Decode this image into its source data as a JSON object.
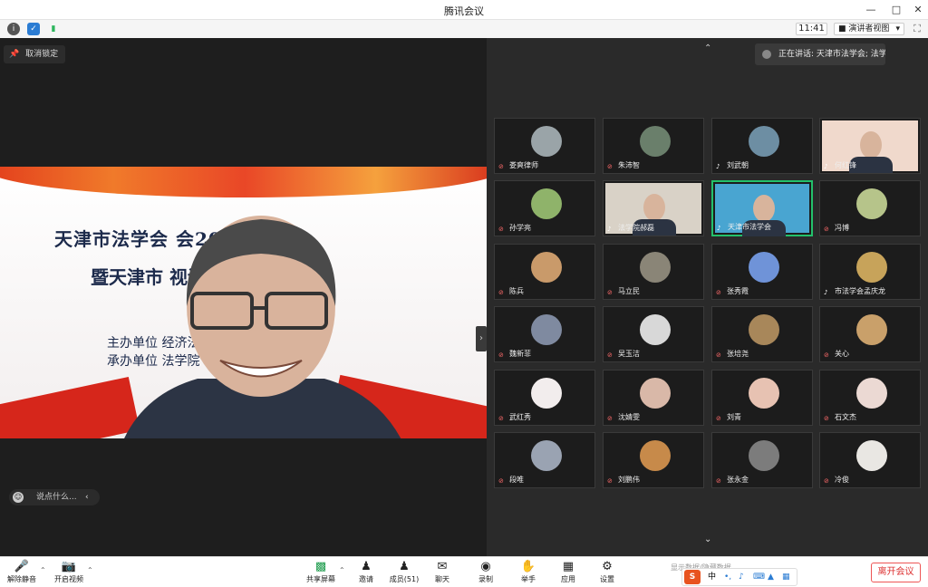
{
  "window": {
    "title": "腾讯会议"
  },
  "infobar": {
    "time": "11:41",
    "view_mode": "演讲者视图"
  },
  "main": {
    "unlock_label": "取消锁定",
    "slide": {
      "line1": "天津市法学会              会2022年年会",
      "line2": "暨天津市              视论坛",
      "line3": "主办单位              经济法学分会",
      "line4": "承办单位              法学院"
    },
    "comment_placeholder": "说点什么..."
  },
  "gallery": {
    "speaking_label": "正在讲话: 天津市法学会; 法学...",
    "participants": [
      {
        "name": "娄爽律师",
        "muted": true,
        "color": "#9aa4a8",
        "type": "photo"
      },
      {
        "name": "朱沛智",
        "muted": true,
        "color": "#6a7f6b",
        "type": "photo"
      },
      {
        "name": "刘武朝",
        "muted": false,
        "color": "#6d8ea3",
        "type": "photo"
      },
      {
        "name": "何红锋",
        "muted": false,
        "color": "#f0d9cc",
        "type": "video"
      },
      {
        "name": "孙学亮",
        "muted": true,
        "color": "#8fb36a",
        "type": "photo"
      },
      {
        "name": "法学院郝磊",
        "muted": false,
        "color": "#d9d2c7",
        "type": "video"
      },
      {
        "name": "天津市法学会",
        "muted": false,
        "color": "#49a5d1",
        "type": "video",
        "active": true
      },
      {
        "name": "冯博",
        "muted": true,
        "color": "#b6c48a",
        "type": "photo"
      },
      {
        "name": "陈兵",
        "muted": true,
        "color": "#c99a6a",
        "type": "photo"
      },
      {
        "name": "马立民",
        "muted": true,
        "color": "#8a8577",
        "type": "photo"
      },
      {
        "name": "张秀霞",
        "muted": true,
        "color": "#6f93d8",
        "type": "photo"
      },
      {
        "name": "市法学会孟庆龙",
        "muted": false,
        "color": "#c7a35a",
        "type": "photo"
      },
      {
        "name": "魏新菲",
        "muted": true,
        "color": "#7f8aa0",
        "type": "photo"
      },
      {
        "name": "吴玉洁",
        "muted": true,
        "color": "#d8d8d8",
        "type": "photo"
      },
      {
        "name": "张培尧",
        "muted": true,
        "color": "#a8875a",
        "type": "photo"
      },
      {
        "name": "关心",
        "muted": true,
        "color": "#c9a06a",
        "type": "photo"
      },
      {
        "name": "武红秀",
        "muted": true,
        "color": "#f2eded",
        "type": "photo"
      },
      {
        "name": "沈婧雯",
        "muted": true,
        "color": "#d9b8a8",
        "type": "photo"
      },
      {
        "name": "刘青",
        "muted": true,
        "color": "#e7c2b2",
        "type": "photo"
      },
      {
        "name": "石文杰",
        "muted": true,
        "color": "#ebd9d3",
        "type": "photo"
      },
      {
        "name": "段唯",
        "muted": true,
        "color": "#9aa3b2",
        "type": "photo"
      },
      {
        "name": "刘鹏伟",
        "muted": true,
        "color": "#c78a4a",
        "type": "photo"
      },
      {
        "name": "张永金",
        "muted": true,
        "color": "#7c7c7c",
        "type": "photo"
      },
      {
        "name": "冷俊",
        "muted": true,
        "color": "#e9e7e3",
        "type": "photo"
      }
    ]
  },
  "toolbar": {
    "unmute": "解除静音",
    "start_video": "开启视频",
    "share": "共享屏幕",
    "invite": "邀请",
    "members": "成员(51)",
    "chat": "聊天",
    "record": "录制",
    "raise_hand": "举手",
    "apps": "应用",
    "settings": "设置",
    "leave": "离开会议",
    "hint": "显示数据/隐藏数据",
    "ime_lang": "中"
  }
}
